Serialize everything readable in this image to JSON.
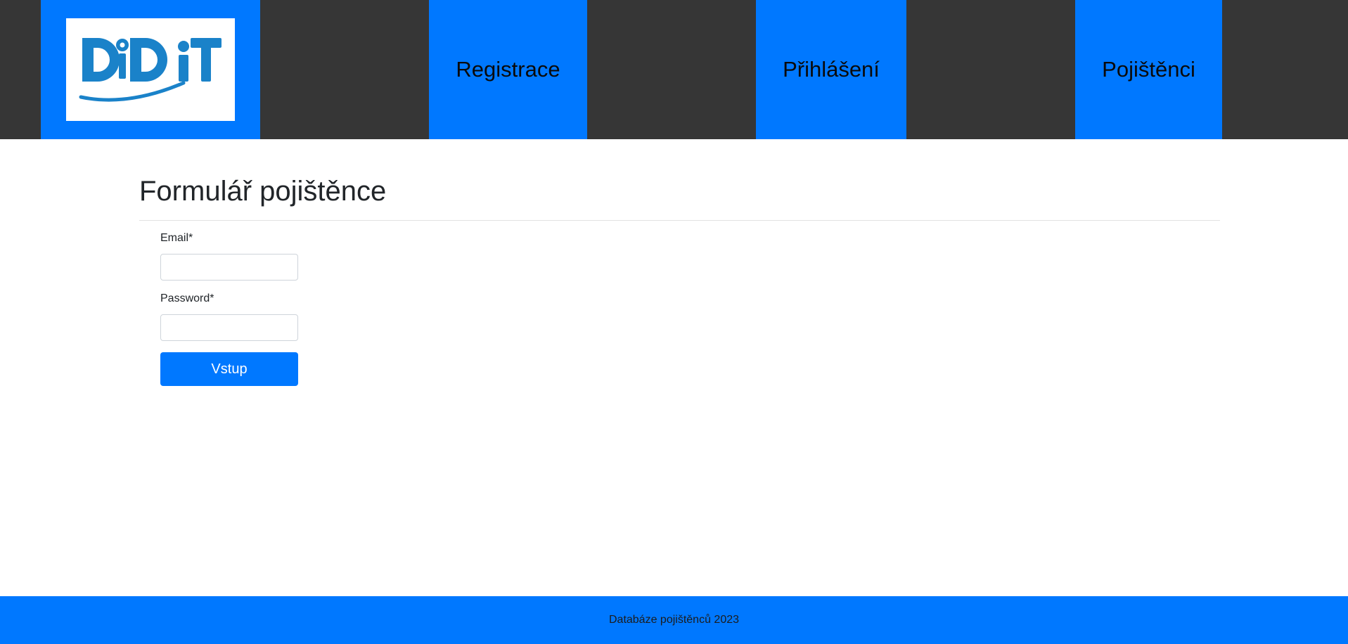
{
  "header": {
    "logo": {
      "text": "DDiT",
      "icon": "ddit-logo",
      "color": "#1a82c9"
    },
    "nav": [
      {
        "label": "Registrace"
      },
      {
        "label": "Přihlášení"
      },
      {
        "label": "Pojištěnci"
      }
    ]
  },
  "main": {
    "title": "Formulář pojištěnce",
    "form": {
      "email_label": "Email*",
      "email_value": "",
      "password_label": "Password*",
      "password_value": "",
      "submit_label": "Vstup"
    }
  },
  "footer": {
    "text": "Databáze pojištěnců 2023"
  },
  "colors": {
    "header_bg": "#363636",
    "accent": "#0078ff",
    "page_bg": "#ffffff"
  }
}
